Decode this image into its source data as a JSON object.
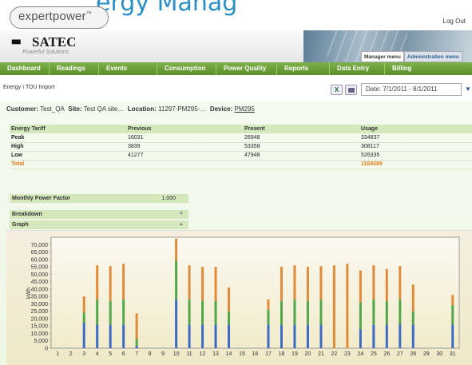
{
  "banner_text": "ergy Manag",
  "brand": {
    "name": "expertpower",
    "tm": "™"
  },
  "header": {
    "logout": "Log Out",
    "satec_name": "SATEC",
    "satec_tagline": "Powerful Solutions",
    "menus": [
      "Manager menu",
      "Administration menu"
    ]
  },
  "nav": {
    "items": [
      "Dashboard",
      "Readings",
      "Events",
      "Consumption",
      "Power Quality",
      "Reports",
      "Data Entry",
      "Billing"
    ]
  },
  "breadcrumb": {
    "parent": "Energy",
    "sep": " \\ ",
    "current": "TOU Import"
  },
  "toolbar": {
    "date_label": "Date: 7/1/2011 - 8/1/2011"
  },
  "customer_bar": {
    "customer_label": "Customer:",
    "customer": "Test_QA",
    "site_label": "Site:",
    "site": "Test QA site…",
    "location_label": "Location:",
    "location": "11297-PM295-…",
    "device_label": "Device:",
    "device": "PM295"
  },
  "tariff_table": {
    "headers": [
      "Energy Tariff",
      "Previous",
      "Present",
      "Usage"
    ],
    "rows": [
      [
        "Peak",
        "16031",
        "26948",
        "334837"
      ],
      [
        "High",
        "3839",
        "53358",
        "308117"
      ],
      [
        "Low",
        "41277",
        "47948",
        "526335"
      ]
    ],
    "total": [
      "Total",
      "",
      "",
      "1169289"
    ]
  },
  "power_factor": {
    "label": "Monthly Power Factor",
    "value": "1.000"
  },
  "breakdown": {
    "label": "Breakdown"
  },
  "graph": {
    "label": "Graph"
  },
  "colors": {
    "low": "#3d6bc4",
    "high": "#52a64a",
    "peak": "#e08b3a"
  },
  "chart_data": {
    "type": "bar",
    "stacked": true,
    "ylabel": "kWh",
    "xlabel": "",
    "ylim": [
      0,
      75000
    ],
    "yticks": [
      "0",
      "5,000",
      "10,000",
      "15,000",
      "20,000",
      "25,000",
      "30,000",
      "35,000",
      "40,000",
      "45,000",
      "50,000",
      "55,000",
      "60,000",
      "65,000",
      "70,000"
    ],
    "categories": [
      "1",
      "2",
      "3",
      "4",
      "5",
      "6",
      "7",
      "8",
      "9",
      "10",
      "11",
      "12",
      "13",
      "14",
      "15",
      "16",
      "17",
      "18",
      "19",
      "20",
      "21",
      "22",
      "23",
      "24",
      "25",
      "26",
      "27",
      "28",
      "29",
      "30",
      "31"
    ],
    "series": [
      {
        "color": "#3d6bc4",
        "values": [
          0,
          0,
          17000,
          16000,
          16000,
          16000,
          1500,
          0,
          0,
          33000,
          16000,
          16000,
          16000,
          16000,
          0,
          0,
          16000,
          16000,
          16000,
          16000,
          16000,
          0,
          0,
          13000,
          16000,
          16000,
          16000,
          16000,
          0,
          0,
          16000
        ]
      },
      {
        "color": "#52a64a",
        "values": [
          0,
          0,
          7000,
          17000,
          16000,
          17000,
          5000,
          0,
          0,
          26000,
          17000,
          16000,
          16000,
          9000,
          0,
          0,
          10000,
          16000,
          17000,
          16000,
          17000,
          0,
          0,
          18000,
          17000,
          16000,
          17000,
          9000,
          0,
          0,
          13000
        ]
      },
      {
        "color": "#e08b3a",
        "values": [
          0,
          0,
          11000,
          23000,
          23500,
          24000,
          17000,
          0,
          0,
          15000,
          23000,
          23000,
          23000,
          16000,
          0,
          0,
          7000,
          23000,
          23000,
          23000,
          22500,
          56000,
          57000,
          21500,
          23000,
          21500,
          22500,
          18000,
          0,
          0,
          7000
        ]
      }
    ]
  }
}
